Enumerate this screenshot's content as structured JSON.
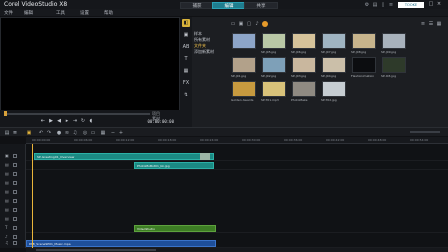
{
  "app": {
    "title": "Corel VideoStudio X8"
  },
  "menu": [
    {
      "label": "文件"
    },
    {
      "label": "编辑"
    },
    {
      "label": "工具"
    },
    {
      "label": "设置"
    },
    {
      "label": "帮助"
    }
  ],
  "steps": [
    {
      "label": "捕获"
    },
    {
      "label": "编辑"
    },
    {
      "label": "共享"
    }
  ],
  "topbar": {
    "badge": "TOOKE"
  },
  "player": {
    "timecode": "00:00:00:00",
    "project_label": "项目",
    "clip_label": "素材"
  },
  "library": {
    "folders": [
      {
        "label": "样本"
      },
      {
        "label": "所有素材"
      },
      {
        "label": "文件夹"
      },
      {
        "label": "添加新素材"
      }
    ],
    "items": [
      {
        "label": ""
      },
      {
        "label": "SP-J05.jpg"
      },
      {
        "label": "SP-J06.jpg"
      },
      {
        "label": "SP-J07.jpg"
      },
      {
        "label": "SP-J08.jpg"
      },
      {
        "label": "SP-J09.jpg"
      },
      {
        "label": "SP-J01.jpg"
      },
      {
        "label": "SP-J02.jpg"
      },
      {
        "label": "SP-J03.jpg"
      },
      {
        "label": "SP-J04.jpg"
      },
      {
        "label": "FlashAnimation"
      },
      {
        "label": "SP-I03.jpg"
      },
      {
        "label": "Golden Awards"
      },
      {
        "label": "SP-T01.mp3"
      },
      {
        "label": "PhotoMake"
      },
      {
        "label": "SP-T02.jpg"
      }
    ]
  },
  "timeline": {
    "ticks": [
      "00:00:00:00",
      "00:00:06:00",
      "00:00:12:00",
      "00:00:18:00",
      "00:00:24:00",
      "00:00:30:00",
      "00:00:36:00",
      "00:00:42:00",
      "00:00:48:00",
      "00:00:54:00"
    ],
    "clips": {
      "video": "SP-Greeting01_Overview",
      "overlay": "PhotoMoBot01_bk.jpg",
      "title": "VideoStudio",
      "music": "PAB_SceneSP01_Music.mpa"
    }
  },
  "colors": {
    "accent": "#1f7d8f",
    "playhead": "#e9b43a",
    "clip_teal": "#1b8a83",
    "clip_green": "#3d7d24",
    "clip_blue": "#1e4f9a"
  }
}
